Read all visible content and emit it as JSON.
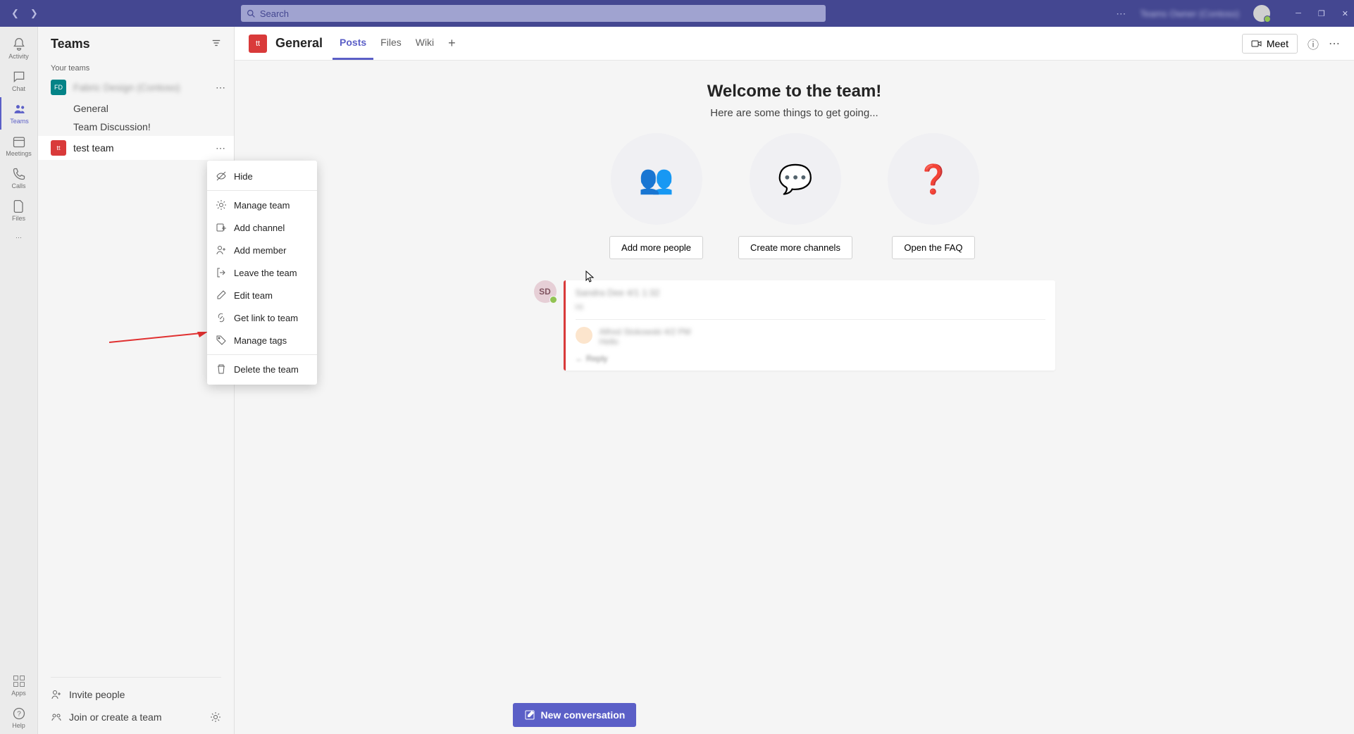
{
  "titlebar": {
    "search_placeholder": "Search",
    "user_name": "Teams Owner (Contoso)"
  },
  "rail": {
    "items": [
      {
        "label": "Activity"
      },
      {
        "label": "Chat"
      },
      {
        "label": "Teams"
      },
      {
        "label": "Meetings"
      },
      {
        "label": "Calls"
      },
      {
        "label": "Files"
      }
    ],
    "apps_label": "Apps",
    "help_label": "Help"
  },
  "sidebar": {
    "title": "Teams",
    "section_label": "Your teams",
    "teams": [
      {
        "initials": "FD",
        "name": "Fabric Design (Contoso)",
        "channels": [
          "General",
          "Team Discussion!"
        ]
      },
      {
        "initials": "tt",
        "name": "test team"
      }
    ],
    "invite_label": "Invite people",
    "join_label": "Join or create a team"
  },
  "context_menu": {
    "items": [
      {
        "label": "Hide",
        "icon": "hide"
      },
      {
        "label": "Manage team",
        "icon": "gear"
      },
      {
        "label": "Add channel",
        "icon": "add-channel"
      },
      {
        "label": "Add member",
        "icon": "add-member"
      },
      {
        "label": "Leave the team",
        "icon": "leave"
      },
      {
        "label": "Edit team",
        "icon": "edit"
      },
      {
        "label": "Get link to team",
        "icon": "link"
      },
      {
        "label": "Manage tags",
        "icon": "tag"
      },
      {
        "label": "Delete the team",
        "icon": "trash"
      }
    ]
  },
  "header": {
    "team_initials": "tt",
    "channel_name": "General",
    "tabs": [
      "Posts",
      "Files",
      "Wiki"
    ],
    "meet_label": "Meet"
  },
  "welcome": {
    "title": "Welcome to the team!",
    "subtitle": "Here are some things to get going...",
    "cards": [
      {
        "button": "Add more people"
      },
      {
        "button": "Create more channels"
      },
      {
        "button": "Open the FAQ"
      }
    ]
  },
  "post": {
    "avatar_initials": "SD",
    "author": "Sandra Dee  4/1 1:32",
    "text": "Hi",
    "reply_author": "Alfred Stokowski  4/2 PM",
    "reply_text": "Hello",
    "reply_link": "← Reply"
  },
  "compose": {
    "new_conversation": "New conversation"
  }
}
